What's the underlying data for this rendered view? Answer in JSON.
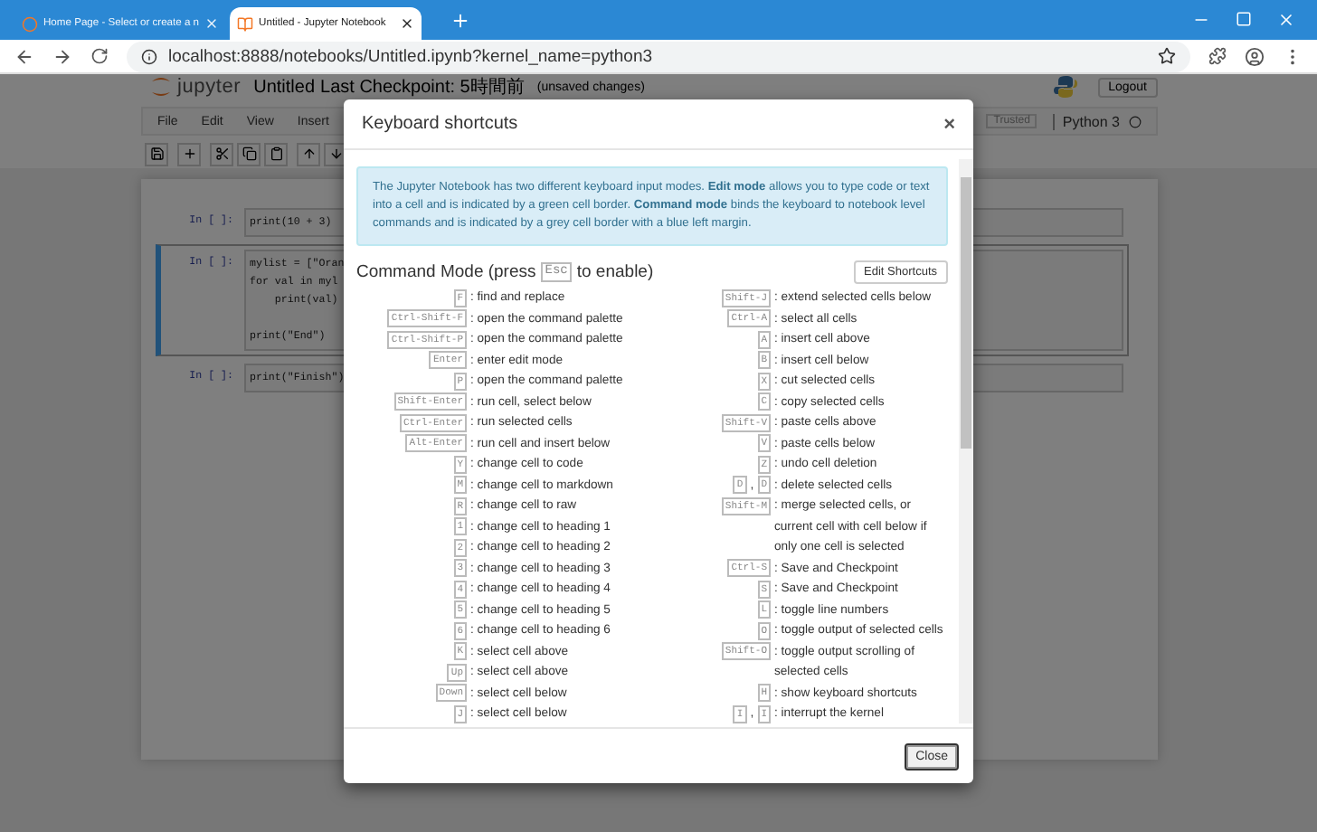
{
  "browser": {
    "tabs": [
      {
        "title": "Home Page - Select or create a n",
        "selected": false
      },
      {
        "title": "Untitled - Jupyter Notebook",
        "selected": true
      }
    ],
    "address": "localhost:8888/notebooks/Untitled.ipynb?kernel_name=python3"
  },
  "notebook": {
    "logo_text": "jupyter",
    "title": "Untitled",
    "checkpoint": "Last Checkpoint: 5時間前",
    "save_status": "(unsaved changes)",
    "logout": "Logout",
    "menu": [
      "File",
      "Edit",
      "View",
      "Insert"
    ],
    "trusted": "Trusted",
    "kernel": "Python 3",
    "cells": [
      {
        "prompt": "In [ ]:",
        "selected": false,
        "lines": [
          {
            "kind": "code",
            "text": "print(10 + 3)"
          }
        ]
      },
      {
        "prompt": "In [ ]:",
        "selected": true,
        "lines": [
          {
            "kind": "code",
            "text": "mylist = [\"Oran"
          },
          {
            "kind": "code",
            "text": "for val in myl"
          },
          {
            "kind": "code",
            "text": "    print(val)"
          },
          {
            "kind": "blank"
          },
          {
            "kind": "code",
            "text": "print(\"End\")"
          }
        ]
      },
      {
        "prompt": "In [ ]:",
        "selected": false,
        "lines": [
          {
            "kind": "code",
            "text": "print(\"Finish\")"
          }
        ]
      }
    ]
  },
  "dialog": {
    "title": "Keyboard shortcuts",
    "close_icon": "×",
    "intro": "The Jupyter Notebook has two different keyboard input modes. **Edit mode** allows you to type code or text into a cell and is indicated by a green cell border. **Command mode** binds the keyboard to notebook level commands and is indicated by a grey cell border with a blue left margin.",
    "heading": {
      "prefix": "Command Mode (press",
      "key": "Esc",
      "suffix": "to enable)"
    },
    "edit_button": "Edit Shortcuts",
    "columns": [
      [
        {
          "keys": [
            "F"
          ],
          "action": ": find and replace"
        },
        {
          "keys": [
            "Ctrl-Shift-F"
          ],
          "action": ": open the command palette"
        },
        {
          "keys": [
            "Ctrl-Shift-P"
          ],
          "action": ": open the command palette"
        },
        {
          "keys": [
            "Enter"
          ],
          "action": ": enter edit mode"
        },
        {
          "keys": [
            "P"
          ],
          "action": ": open the command palette"
        },
        {
          "keys": [
            "Shift-Enter"
          ],
          "action": ": run cell, select below"
        },
        {
          "keys": [
            "Ctrl-Enter"
          ],
          "action": ": run selected cells"
        },
        {
          "keys": [
            "Alt-Enter"
          ],
          "action": ": run cell and insert below"
        },
        {
          "keys": [
            "Y"
          ],
          "action": ": change cell to code"
        },
        {
          "keys": [
            "M"
          ],
          "action": ": change cell to markdown"
        },
        {
          "keys": [
            "R"
          ],
          "action": ": change cell to raw"
        },
        {
          "keys": [
            "1"
          ],
          "action": ": change cell to heading 1"
        },
        {
          "keys": [
            "2"
          ],
          "action": ": change cell to heading 2"
        },
        {
          "keys": [
            "3"
          ],
          "action": ": change cell to heading 3"
        },
        {
          "keys": [
            "4"
          ],
          "action": ": change cell to heading 4"
        },
        {
          "keys": [
            "5"
          ],
          "action": ": change cell to heading 5"
        },
        {
          "keys": [
            "6"
          ],
          "action": ": change cell to heading 6"
        },
        {
          "keys": [
            "K"
          ],
          "action": ": select cell above"
        },
        {
          "keys": [
            "Up"
          ],
          "action": ": select cell above"
        },
        {
          "keys": [
            "Down"
          ],
          "action": ": select cell below"
        },
        {
          "keys": [
            "J"
          ],
          "action": ": select cell below"
        }
      ],
      [
        {
          "keys": [
            "Shift-J"
          ],
          "action": ": extend selected cells below"
        },
        {
          "keys": [
            "Ctrl-A"
          ],
          "action": ": select all cells"
        },
        {
          "keys": [
            "A"
          ],
          "action": ": insert cell above"
        },
        {
          "keys": [
            "B"
          ],
          "action": ": insert cell below"
        },
        {
          "keys": [
            "X"
          ],
          "action": ": cut selected cells"
        },
        {
          "keys": [
            "C"
          ],
          "action": ": copy selected cells"
        },
        {
          "keys": [
            "Shift-V"
          ],
          "action": ": paste cells above"
        },
        {
          "keys": [
            "V"
          ],
          "action": ": paste cells below"
        },
        {
          "keys": [
            "Z"
          ],
          "action": ": undo cell deletion"
        },
        {
          "keys": [
            "D",
            "D"
          ],
          "joiner": ",",
          "action": ": delete selected cells"
        },
        {
          "keys": [
            "Shift-M"
          ],
          "action": ": merge selected cells, or current cell with cell below if only one cell is selected"
        },
        {
          "keys": [
            "Ctrl-S"
          ],
          "action": ": Save and Checkpoint"
        },
        {
          "keys": [
            "S"
          ],
          "action": ": Save and Checkpoint"
        },
        {
          "keys": [
            "L"
          ],
          "action": ": toggle line numbers"
        },
        {
          "keys": [
            "O"
          ],
          "action": ": toggle output of selected cells"
        },
        {
          "keys": [
            "Shift-O"
          ],
          "action": ": toggle output scrolling of selected cells"
        },
        {
          "keys": [
            "H"
          ],
          "action": ": show keyboard shortcuts"
        },
        {
          "keys": [
            "I",
            "I"
          ],
          "joiner": ",",
          "action": ": interrupt the kernel"
        }
      ]
    ],
    "close_button": "Close"
  }
}
